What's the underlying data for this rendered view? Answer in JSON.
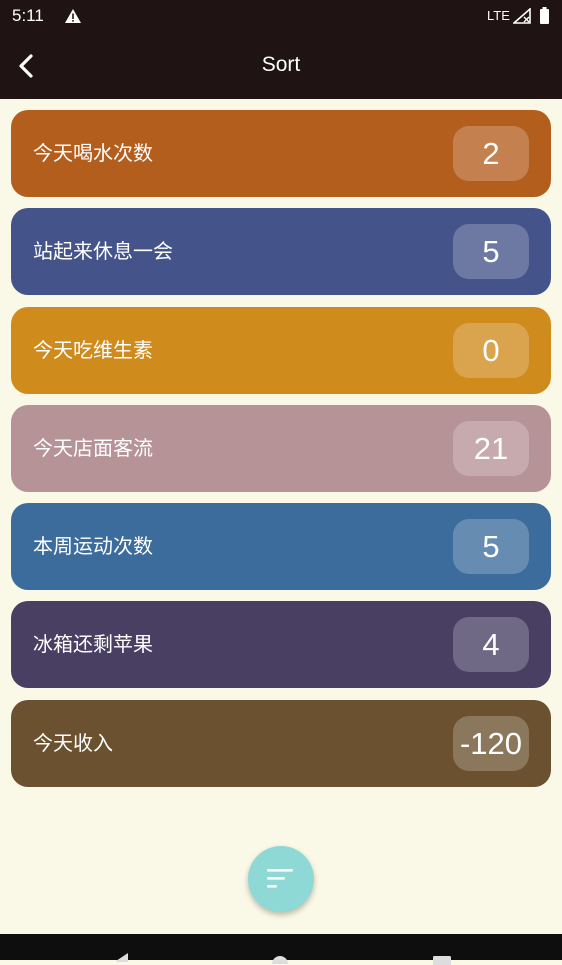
{
  "status_bar": {
    "time": "5:11",
    "network": "LTE",
    "icons": [
      "warning-icon",
      "signal-icon",
      "battery-icon"
    ]
  },
  "app_bar": {
    "title": "Sort",
    "back_icon": "chevron-left-icon"
  },
  "items": [
    {
      "label": "今天喝水次数",
      "count": "2",
      "color": "#B45E1E"
    },
    {
      "label": "站起来休息一会",
      "count": "5",
      "color": "#44548A"
    },
    {
      "label": "今天吃维生素",
      "count": "0",
      "color": "#D08B1D"
    },
    {
      "label": "今天店面客流",
      "count": "21",
      "color": "#B69396"
    },
    {
      "label": "本周运动次数",
      "count": "5",
      "color": "#3C6C9C"
    },
    {
      "label": "冰箱还剩苹果",
      "count": "4",
      "color": "#483F63"
    },
    {
      "label": "今天收入",
      "count": "-120",
      "color": "#6B512F"
    }
  ],
  "fab": {
    "icon": "sort-icon",
    "color": "#8ED9D6"
  },
  "nav_bar": {
    "icons": [
      "nav-back-icon",
      "nav-home-icon",
      "nav-recent-icon"
    ]
  }
}
